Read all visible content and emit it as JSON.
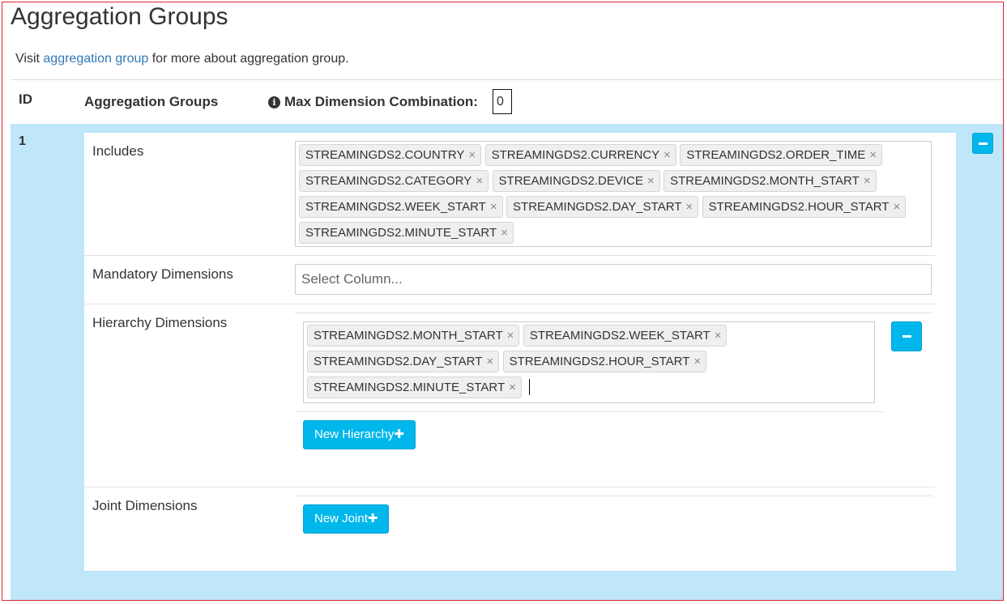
{
  "page": {
    "title": "Aggregation Groups",
    "visit_prefix": "Visit ",
    "visit_link": "aggregation group",
    "visit_suffix": " for more about aggregation group."
  },
  "table_header": {
    "id": "ID",
    "groups": "Aggregation Groups",
    "max_dim": "Max Dimension Combination:",
    "max_dim_value": "0"
  },
  "group": {
    "id": "1",
    "includes_label": "Includes",
    "includes": [
      "STREAMINGDS2.COUNTRY",
      "STREAMINGDS2.CURRENCY",
      "STREAMINGDS2.ORDER_TIME",
      "STREAMINGDS2.CATEGORY",
      "STREAMINGDS2.DEVICE",
      "STREAMINGDS2.MONTH_START",
      "STREAMINGDS2.WEEK_START",
      "STREAMINGDS2.DAY_START",
      "STREAMINGDS2.HOUR_START",
      "STREAMINGDS2.MINUTE_START"
    ],
    "mandatory_label": "Mandatory Dimensions",
    "mandatory_placeholder": "Select Column...",
    "hierarchy_label": "Hierarchy Dimensions",
    "hierarchy": [
      "STREAMINGDS2.MONTH_START",
      "STREAMINGDS2.WEEK_START",
      "STREAMINGDS2.DAY_START",
      "STREAMINGDS2.HOUR_START",
      "STREAMINGDS2.MINUTE_START"
    ],
    "new_hierarchy": "New Hierarchy",
    "joint_label": "Joint Dimensions",
    "new_joint": "New Joint"
  },
  "icons": {
    "remove_tag": "×",
    "info": "i",
    "plus": "✚"
  },
  "colors": {
    "accent": "#00b7ec",
    "group_bg": "#bfe6f9",
    "link": "#337ab7",
    "frame_border": "#d9262c"
  }
}
